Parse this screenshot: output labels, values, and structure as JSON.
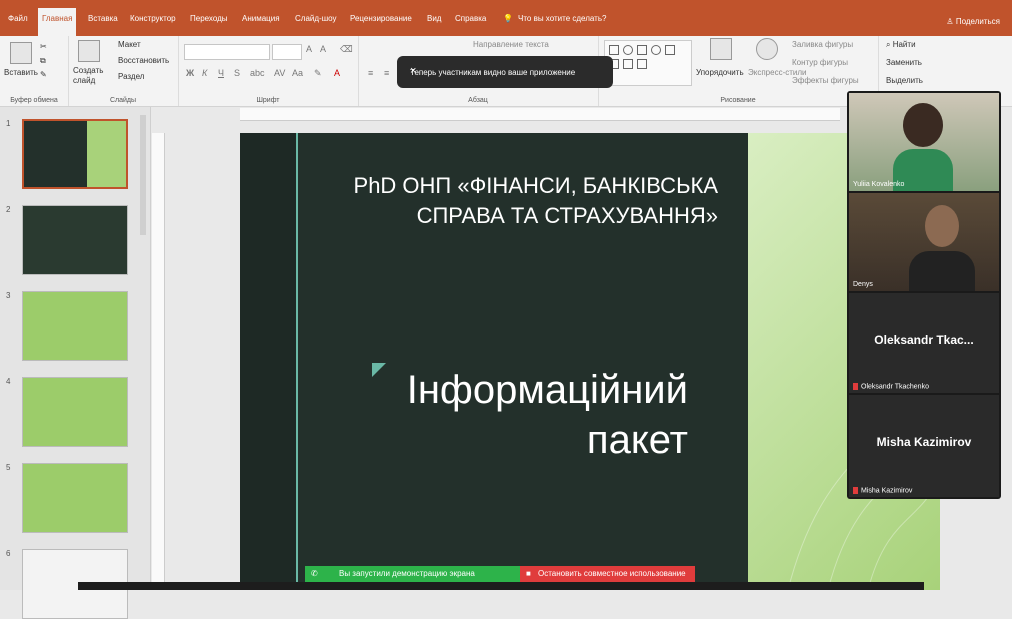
{
  "ribbon": {
    "tabs": [
      "Файл",
      "Главная",
      "Вставка",
      "Конструктор",
      "Переходы",
      "Анимация",
      "Слайд-шоу",
      "Рецензирование",
      "Вид",
      "Справка"
    ],
    "tell_me": "Что вы хотите сделать?",
    "share": "Поделиться",
    "clipboard": {
      "paste": "Вставить",
      "label": "Буфер обмена"
    },
    "slides": {
      "new_slide": "Создать слайд",
      "layout": "Макет",
      "reset": "Восстановить",
      "section": "Раздел",
      "label": "Слайды"
    },
    "font": {
      "label": "Шрифт"
    },
    "paragraph": {
      "text_direction": "Направление текста",
      "label": "Абзац"
    },
    "drawing": {
      "arrange": "Упорядочить",
      "quick_styles": "Экспресс-стили",
      "fill": "Заливка фигуры",
      "outline": "Контур фигуры",
      "effects": "Эффекты фигуры",
      "label": "Рисование"
    },
    "editing": {
      "find": "Найти",
      "replace": "Заменить",
      "select": "Выделить"
    }
  },
  "toast": {
    "text": "Теперь участникам видно ваше приложение",
    "close": "×"
  },
  "thumbnails": [
    "1",
    "2",
    "3",
    "4",
    "5",
    "6"
  ],
  "slide": {
    "title": "PhD ОНП «ФІНАНСИ, БАНКІВСЬКА СПРАВА ТА СТРАХУВАННЯ»",
    "subtitle_line1": "Інформаційний",
    "subtitle_line2": "пакет"
  },
  "share_bar": {
    "started": "Вы запустили демонстрацию экрана",
    "stop": "Остановить совместное использование"
  },
  "participants": [
    {
      "name": "Yuliia Kovalenko"
    },
    {
      "name": "Denys"
    },
    {
      "display": "Oleksandr Tkac...",
      "name": "Oleksandr Tkachenko"
    },
    {
      "display": "Misha Kazimirov",
      "name": "Misha Kazimirov"
    }
  ],
  "colors": {
    "accent": "#c0532c",
    "slide_bg": "#23302b",
    "share_green": "#2db34a",
    "share_red": "#e03c3c"
  }
}
